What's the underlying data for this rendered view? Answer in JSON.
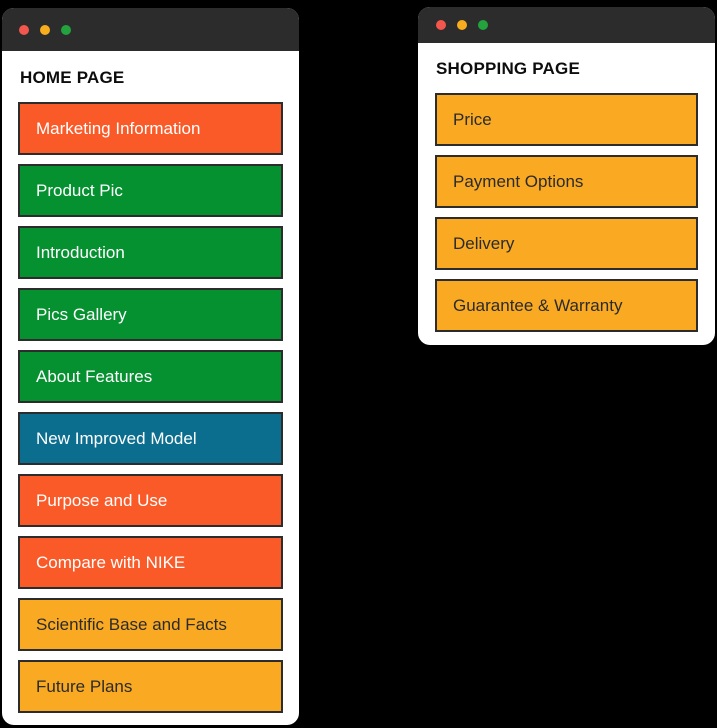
{
  "colors": {
    "canvas": "#000000",
    "window_bg": "#ffffff",
    "titlebar": "#2c2c2c",
    "dot_red": "#f2564c",
    "dot_yellow": "#f7ad1d",
    "dot_green": "#22a33e",
    "orange_red": "#fa5a28",
    "green": "#059130",
    "teal_blue": "#0b6e8f",
    "amber": "#faaa22",
    "border": "#2c2c2c",
    "text_light": "#ffffff",
    "text_dark": "#2b2b2b",
    "title_text": "#0d0d0d"
  },
  "windows": [
    {
      "id": "home",
      "title": "HOME PAGE",
      "traffic_lights": [
        "close-dot",
        "minimize-dot",
        "maximize-dot"
      ],
      "buttons": [
        {
          "label": "Marketing Information",
          "bg": "#fa5a28",
          "fg": "#ffffff"
        },
        {
          "label": "Product Pic",
          "bg": "#059130",
          "fg": "#ffffff"
        },
        {
          "label": "Introduction",
          "bg": "#059130",
          "fg": "#ffffff"
        },
        {
          "label": "Pics Gallery",
          "bg": "#059130",
          "fg": "#ffffff"
        },
        {
          "label": "About Features",
          "bg": "#059130",
          "fg": "#ffffff"
        },
        {
          "label": "New Improved Model",
          "bg": "#0b6e8f",
          "fg": "#ffffff"
        },
        {
          "label": "Purpose and Use",
          "bg": "#fa5a28",
          "fg": "#ffffff"
        },
        {
          "label": "Compare with NIKE",
          "bg": "#fa5a28",
          "fg": "#ffffff"
        },
        {
          "label": "Scientific Base and Facts",
          "bg": "#faaa22",
          "fg": "#2b2b2b"
        },
        {
          "label": "Future Plans",
          "bg": "#faaa22",
          "fg": "#2b2b2b"
        }
      ]
    },
    {
      "id": "shopping",
      "title": "SHOPPING PAGE",
      "traffic_lights": [
        "close-dot",
        "minimize-dot",
        "maximize-dot"
      ],
      "buttons": [
        {
          "label": "Price",
          "bg": "#faaa22",
          "fg": "#2b2b2b"
        },
        {
          "label": "Payment Options",
          "bg": "#faaa22",
          "fg": "#2b2b2b"
        },
        {
          "label": "Delivery",
          "bg": "#faaa22",
          "fg": "#2b2b2b"
        },
        {
          "label": "Guarantee & Warranty",
          "bg": "#faaa22",
          "fg": "#2b2b2b"
        }
      ]
    }
  ]
}
